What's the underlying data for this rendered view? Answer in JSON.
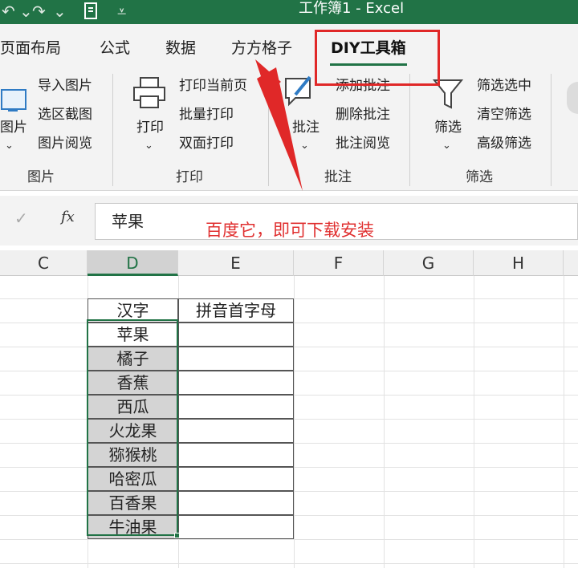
{
  "titlebar": {
    "title": "工作簿1  -  Excel"
  },
  "tabs": [
    {
      "label": "页面布局"
    },
    {
      "label": "公式"
    },
    {
      "label": "数据"
    },
    {
      "label": "方方格子"
    },
    {
      "label": "DIY工具箱"
    }
  ],
  "ribbon": {
    "picture": {
      "big_label": "图片",
      "items": [
        "导入图片",
        "选区截图",
        "图片阅览"
      ],
      "group": "图片"
    },
    "print": {
      "big_label": "打印",
      "items": [
        "打印当前页",
        "批量打印",
        "双面打印"
      ],
      "group": "打印"
    },
    "comment": {
      "big_label": "批注",
      "items": [
        "添加批注",
        "删除批注",
        "批注阅览"
      ],
      "group": "批注"
    },
    "filter": {
      "big_label": "筛选",
      "items": [
        "筛选选中",
        "清空筛选",
        "高级筛选"
      ],
      "group": "筛选"
    }
  },
  "formula_bar": {
    "fx": "fx",
    "value": "苹果"
  },
  "annotation": "百度它，即可下载安装",
  "columns": [
    "C",
    "D",
    "E",
    "F",
    "G",
    "H"
  ],
  "table": {
    "header_d": "汉字",
    "header_e": "拼音首字母",
    "rows": [
      "苹果",
      "橘子",
      "香蕉",
      "西瓜",
      "火龙果",
      "猕猴桃",
      "哈密瓜",
      "百香果",
      "牛油果"
    ]
  }
}
